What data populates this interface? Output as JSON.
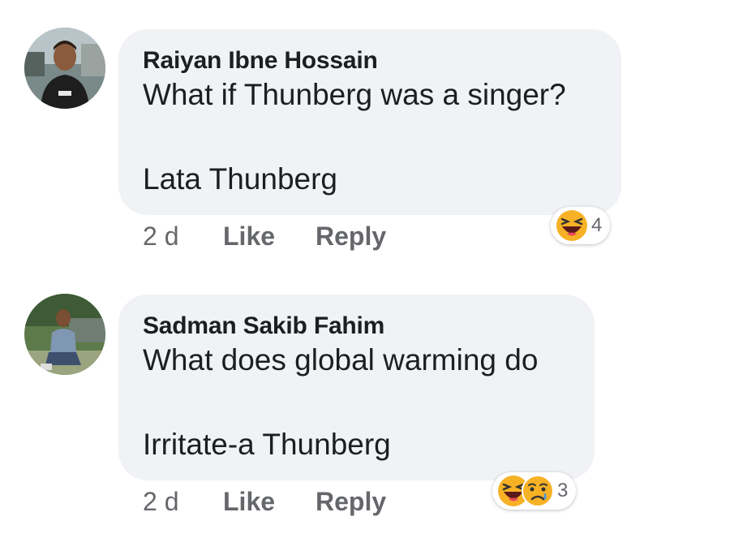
{
  "comments": [
    {
      "author": "Raiyan Ibne Hossain",
      "lines": [
        "What if Thunberg was a singer?",
        "",
        "Lata Thunberg"
      ],
      "time": "2 d",
      "like": "Like",
      "reply": "Reply",
      "reactions": [
        "haha-icon"
      ],
      "reaction_count": "4"
    },
    {
      "author": "Sadman Sakib Fahim",
      "lines": [
        "What does global warming do",
        "",
        "Irritate-a Thunberg"
      ],
      "time": "2 d",
      "like": "Like",
      "reply": "Reply",
      "reactions": [
        "haha-icon",
        "sad-icon"
      ],
      "reaction_count": "3"
    }
  ],
  "colors": {
    "bubble": "#f0f2f5",
    "text": "#1c1e21",
    "meta": "#65676b",
    "emoji_yellow": "#f7b125",
    "tear_blue": "#3b9ae1"
  }
}
